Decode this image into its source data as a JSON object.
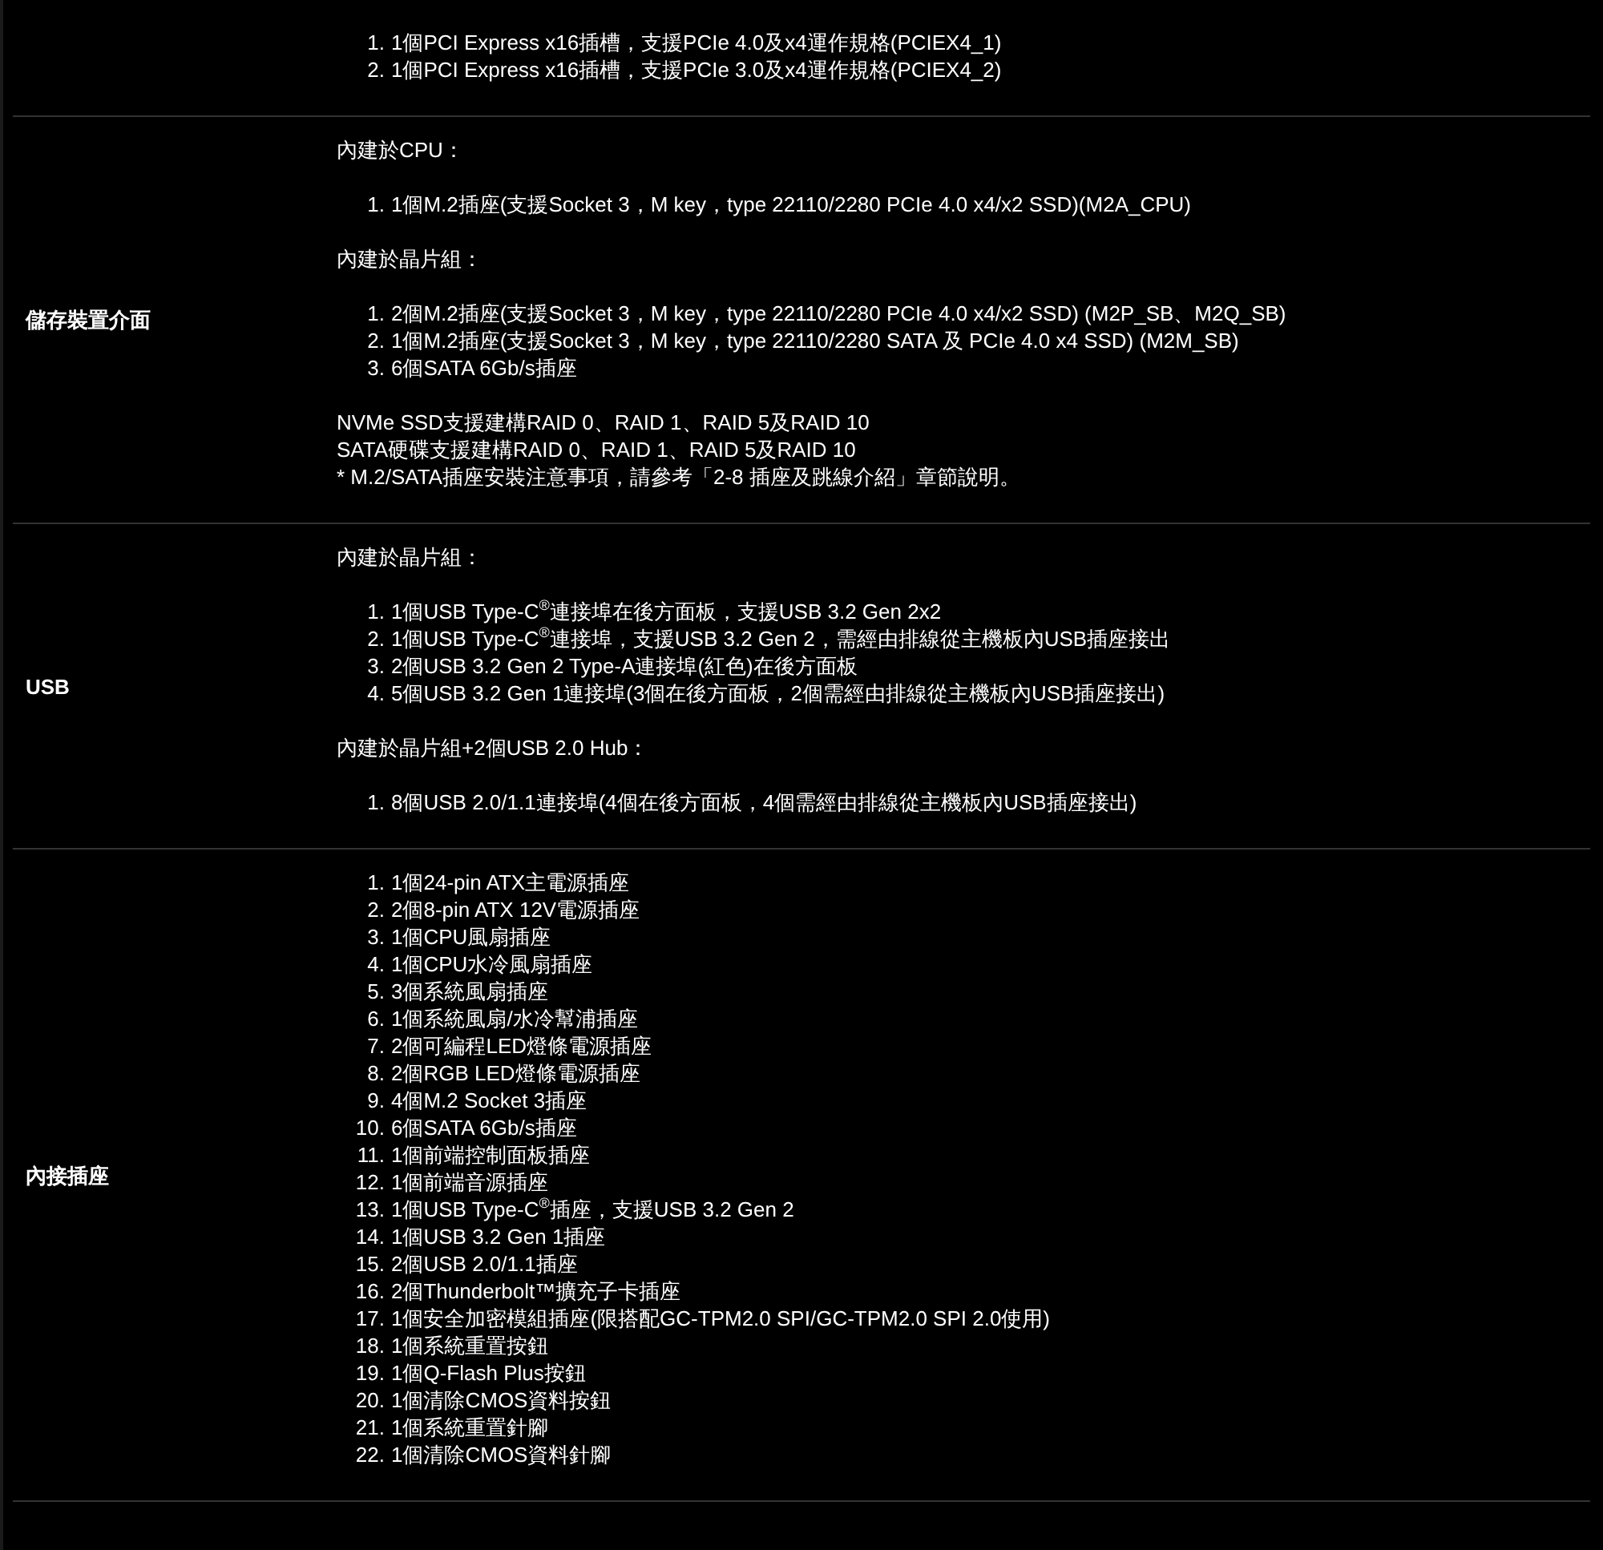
{
  "spec_table": {
    "rows": [
      {
        "blocks": [
          {
            "kind": "list",
            "items": [
              {
                "num": "1.",
                "text": "1個PCI Express x16插槽，支援PCIe 4.0及x4運作規格(PCIEX4_1)"
              },
              {
                "num": "2.",
                "text": "1個PCI Express x16插槽，支援PCIe 3.0及x4運作規格(PCIEX4_2)"
              }
            ]
          }
        ]
      },
      {
        "label": "儲存裝置介面",
        "blocks": [
          {
            "kind": "heading",
            "text": "內建於CPU："
          },
          {
            "kind": "list",
            "items": [
              {
                "num": "1.",
                "text": "1個M.2插座(支援Socket 3，M key，type 22110/2280 PCIe 4.0 x4/x2 SSD)(M2A_CPU)"
              }
            ]
          },
          {
            "kind": "heading",
            "text": "內建於晶片組："
          },
          {
            "kind": "list",
            "items": [
              {
                "num": "1.",
                "text": "2個M.2插座(支援Socket 3，M key，type 22110/2280 PCIe 4.0 x4/x2 SSD) (M2P_SB、M2Q_SB)"
              },
              {
                "num": "2.",
                "text": "1個M.2插座(支援Socket 3，M key，type 22110/2280 SATA 及 PCIe 4.0 x4 SSD) (M2M_SB)"
              },
              {
                "num": "3.",
                "text": "6個SATA 6Gb/s插座"
              }
            ]
          },
          {
            "kind": "note",
            "lines": [
              "NVMe SSD支援建構RAID 0、RAID 1、RAID 5及RAID 10",
              "SATA硬碟支援建構RAID 0、RAID 1、RAID 5及RAID 10",
              "* M.2/SATA插座安裝注意事項，請參考「2-8 插座及跳線介紹」章節說明。"
            ]
          }
        ]
      },
      {
        "label": "USB",
        "blocks": [
          {
            "kind": "heading",
            "text": "內建於晶片組："
          },
          {
            "kind": "list",
            "items": [
              {
                "num": "1.",
                "text": "1個USB Type-C$^{®}$連接埠在後方面板，支援USB 3.2 Gen 2x2"
              },
              {
                "num": "2.",
                "text": "1個USB Type-C$^{®}$連接埠，支援USB 3.2 Gen 2，需經由排線從主機板內USB插座接出"
              },
              {
                "num": "3.",
                "text": "2個USB 3.2 Gen 2 Type-A連接埠(紅色)在後方面板"
              },
              {
                "num": "4.",
                "text": "5個USB 3.2 Gen 1連接埠(3個在後方面板，2個需經由排線從主機板內USB插座接出)"
              }
            ]
          },
          {
            "kind": "heading",
            "text": "內建於晶片組+2個USB 2.0 Hub："
          },
          {
            "kind": "list",
            "items": [
              {
                "num": "1.",
                "text": "8個USB 2.0/1.1連接埠(4個在後方面板，4個需經由排線從主機板內USB插座接出)"
              }
            ]
          }
        ]
      },
      {
        "label": "內接插座",
        "blocks": [
          {
            "kind": "list",
            "items": [
              {
                "num": "1.",
                "text": "1個24-pin ATX主電源插座"
              },
              {
                "num": "2.",
                "text": "2個8-pin ATX 12V電源插座"
              },
              {
                "num": "3.",
                "text": "1個CPU風扇插座"
              },
              {
                "num": "4.",
                "text": "1個CPU水冷風扇插座"
              },
              {
                "num": "5.",
                "text": "3個系統風扇插座"
              },
              {
                "num": "6.",
                "text": "1個系統風扇/水冷幫浦插座"
              },
              {
                "num": "7.",
                "text": "2個可編程LED燈條電源插座"
              },
              {
                "num": "8.",
                "text": "2個RGB LED燈條電源插座"
              },
              {
                "num": "9.",
                "text": "4個M.2 Socket 3插座"
              },
              {
                "num": "10.",
                "text": "6個SATA 6Gb/s插座"
              },
              {
                "num": "11.",
                "text": "1個前端控制面板插座"
              },
              {
                "num": "12.",
                "text": "1個前端音源插座"
              },
              {
                "num": "13.",
                "text": "1個USB Type-C$^{®}$插座，支援USB 3.2 Gen 2"
              },
              {
                "num": "14.",
                "text": "1個USB 3.2 Gen 1插座"
              },
              {
                "num": "15.",
                "text": "2個USB 2.0/1.1插座"
              },
              {
                "num": "16.",
                "text": "2個Thunderbolt™擴充子卡插座"
              },
              {
                "num": "17.",
                "text": "1個安全加密模組插座(限搭配GC-TPM2.0 SPI/GC-TPM2.0 SPI 2.0使用)"
              },
              {
                "num": "18.",
                "text": "1個系統重置按鈕"
              },
              {
                "num": "19.",
                "text": "1個Q-Flash Plus按鈕"
              },
              {
                "num": "20.",
                "text": "1個清除CMOS資料按鈕"
              },
              {
                "num": "21.",
                "text": "1個系統重置針腳"
              },
              {
                "num": "22.",
                "text": "1個清除CMOS資料針腳"
              }
            ]
          }
        ]
      }
    ]
  }
}
